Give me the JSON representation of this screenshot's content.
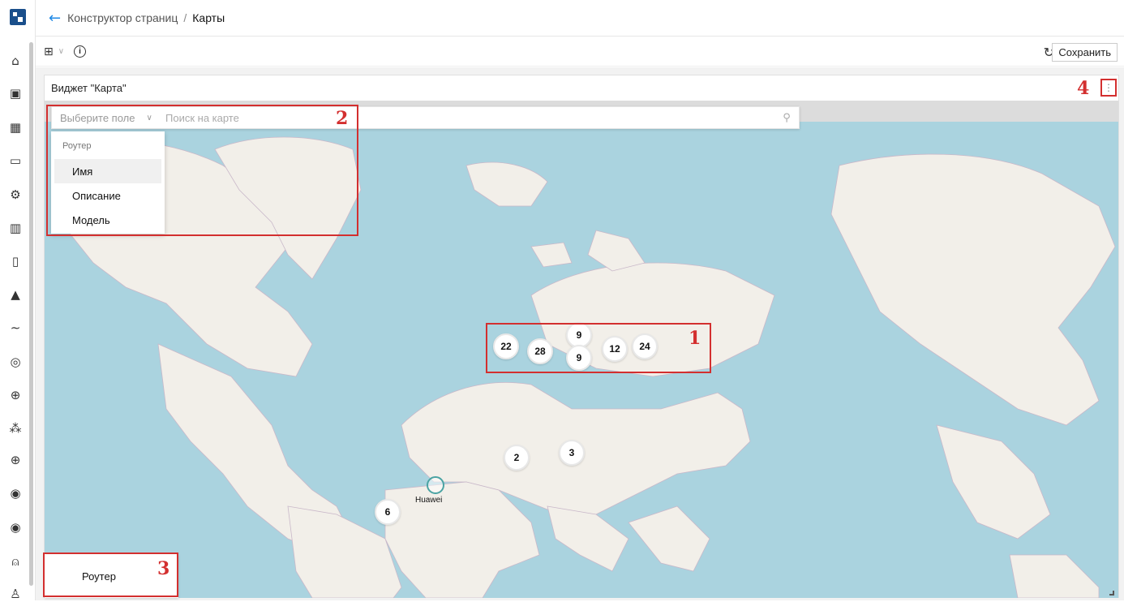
{
  "breadcrumb": {
    "parent": "Конструктор страниц",
    "separator": "/",
    "current": "Карты"
  },
  "toolbar": {
    "save_label": "Сохранить"
  },
  "widget": {
    "title": "Виджет \"Карта\""
  },
  "search": {
    "field_placeholder": "Выберите поле",
    "placeholder": "Поиск на карте"
  },
  "dropdown": {
    "group": "Роутер",
    "items": [
      "Имя",
      "Описание",
      "Модель"
    ],
    "selected": "Имя"
  },
  "clusters": [
    "22",
    "28",
    "9",
    "9",
    "12",
    "24",
    "2",
    "3",
    "6"
  ],
  "marker": {
    "label": "Huawei"
  },
  "legend": {
    "label": "Роутер"
  },
  "annotations": [
    "1",
    "2",
    "3",
    "4"
  ],
  "colors": {
    "accent": "#1e88e5",
    "highlight": "#d32f2f",
    "ocean": "#aad3df",
    "land": "#f2efe9"
  },
  "sidebar_icons": [
    "home-icon",
    "dashboard-icon",
    "table-icon",
    "monitor-icon",
    "gear-icon",
    "bar-chart-icon",
    "document-icon",
    "warning-icon",
    "line-chart-icon",
    "device-icon",
    "globe-icon",
    "topology-icon",
    "globe-icon",
    "eye-icon",
    "eye-icon",
    "alarm-icon",
    "user-icon"
  ]
}
